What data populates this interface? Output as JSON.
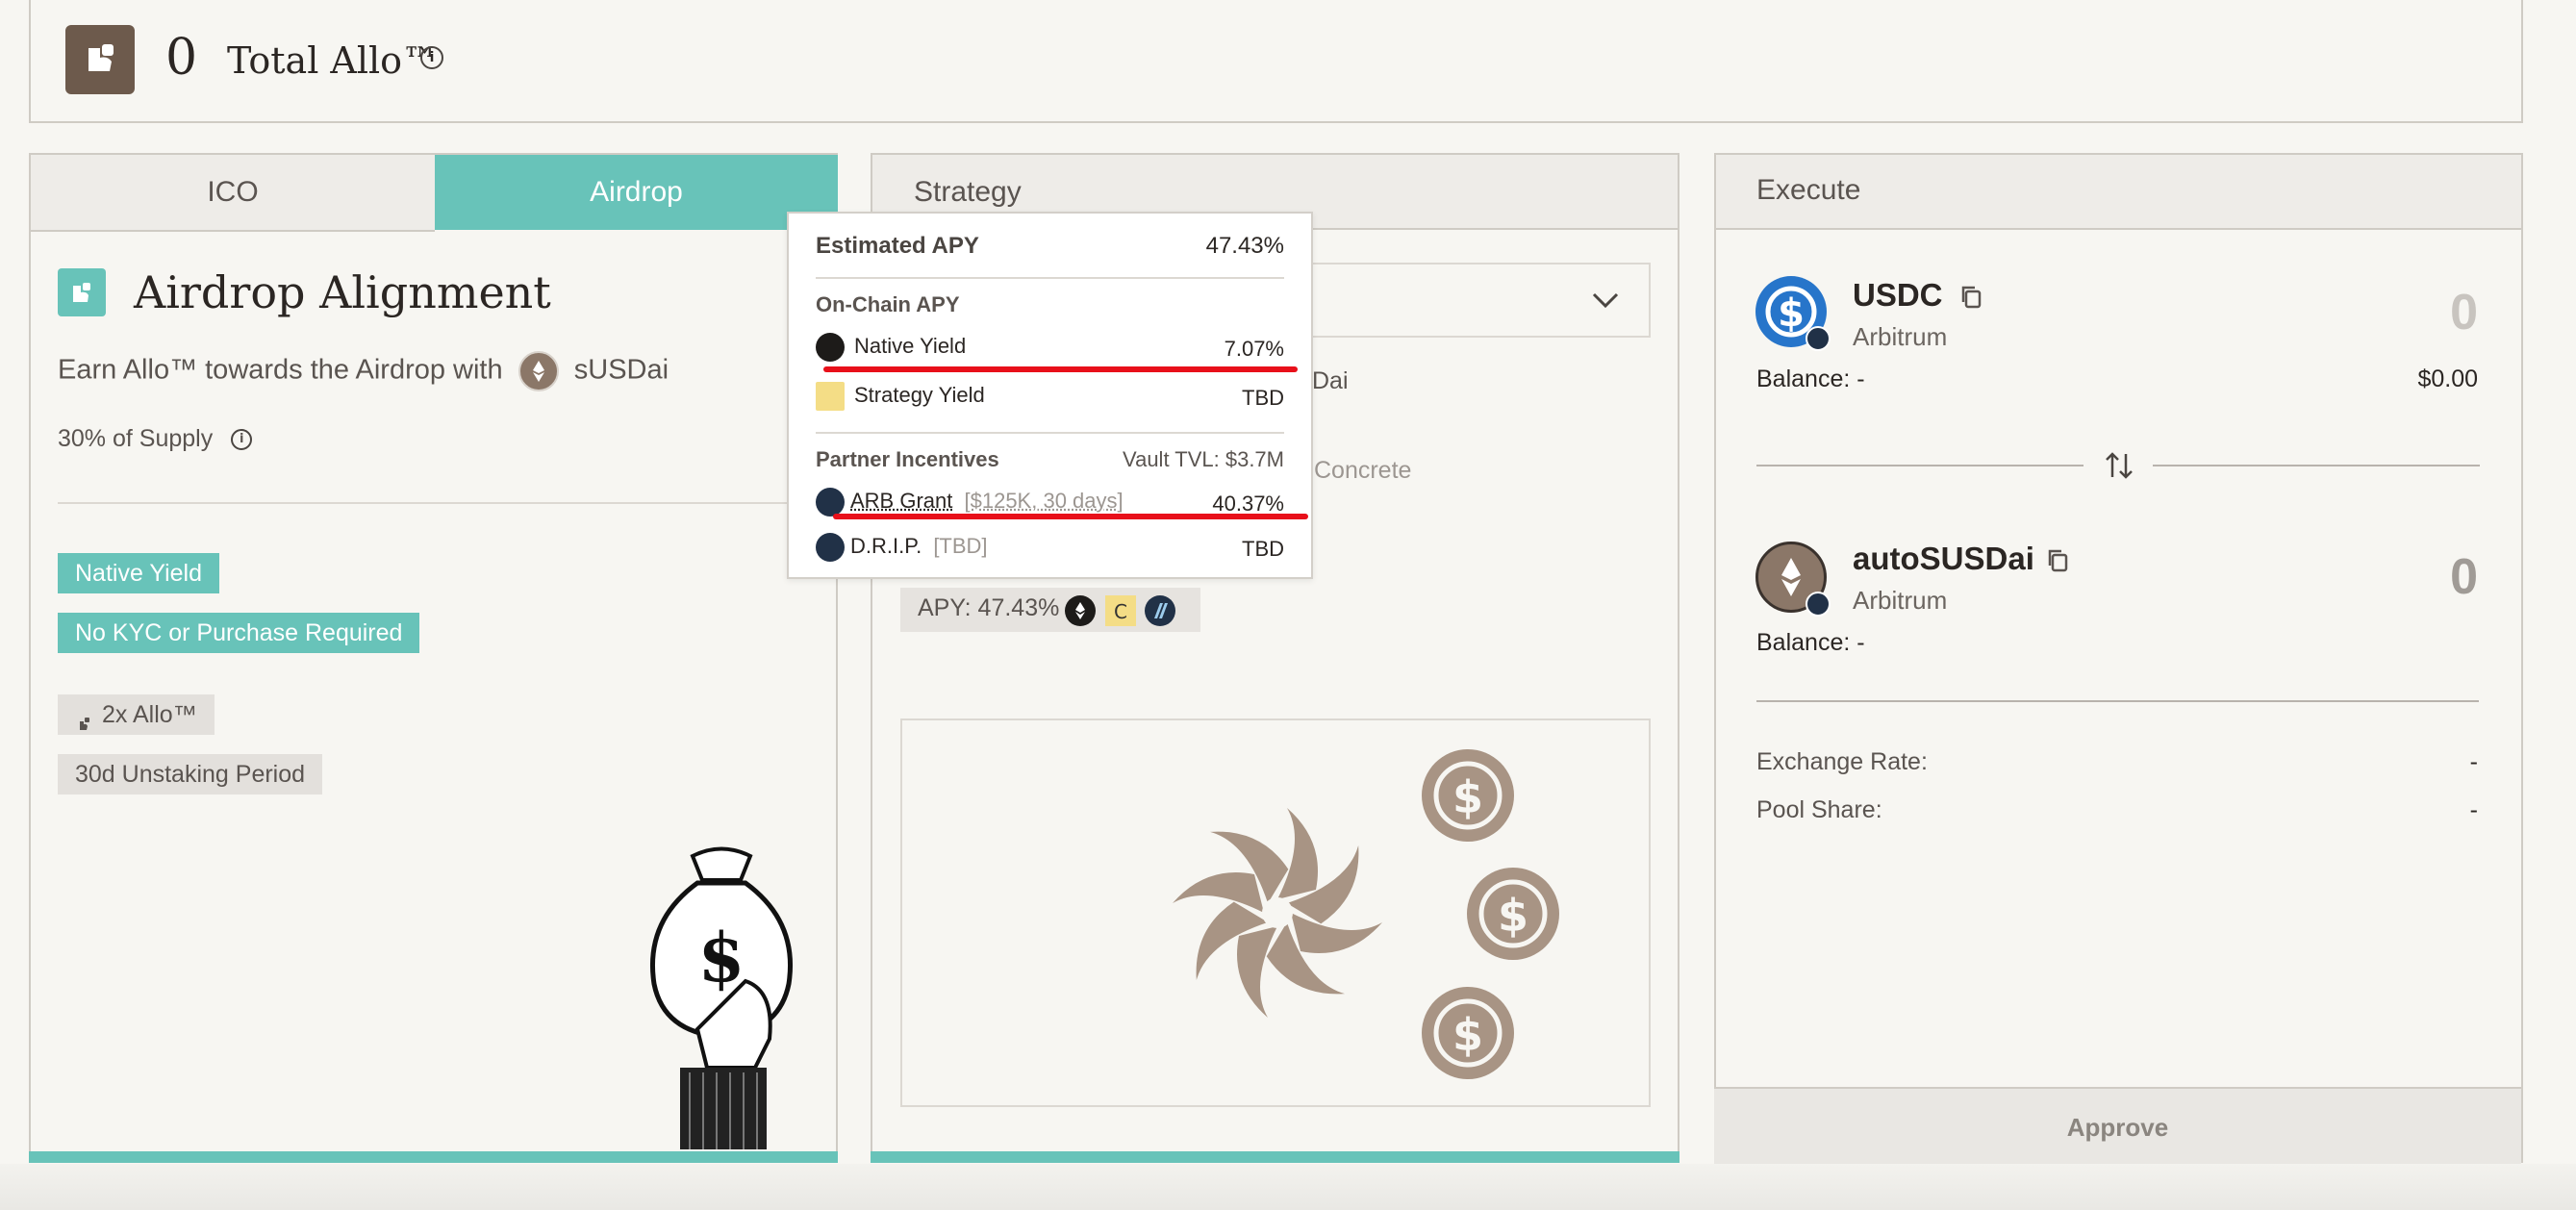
{
  "header": {
    "total_value": "0",
    "total_label": "Total Allo™"
  },
  "tabs": [
    {
      "label": "ICO",
      "active": false
    },
    {
      "label": "Airdrop",
      "active": true
    }
  ],
  "airdrop": {
    "title": "Airdrop Alignment",
    "subtitle_prefix": "Earn Allo™ towards the Airdrop with",
    "token": "sUSDai",
    "supply": "30% of Supply",
    "tags_teal": [
      "Native Yield",
      "No KYC or Purchase Required"
    ],
    "tags_grey": [
      "2x Allo™",
      "30d Unstaking Period"
    ]
  },
  "strategy": {
    "title": "Strategy",
    "partial_text_1": "Dai",
    "partial_text_2": "Concrete",
    "apy_badge": "APY: 47.43%"
  },
  "popup": {
    "estimated_label": "Estimated APY",
    "estimated_value": "47.43%",
    "onchain_label": "On-Chain APY",
    "native_label": "Native Yield",
    "native_value": "7.07%",
    "strategy_label": "Strategy Yield",
    "strategy_value": "TBD",
    "partner_label": "Partner Incentives",
    "vault_tvl": "Vault TVL: $3.7M",
    "arb_label": "ARB Grant",
    "arb_note": "[$125K, 30 days]",
    "arb_value": "40.37%",
    "drip_label": "D.R.I.P.",
    "drip_note": "[TBD]",
    "drip_value": "TBD"
  },
  "execute": {
    "title": "Execute",
    "from": {
      "token": "USDC",
      "network": "Arbitrum",
      "amount": "0",
      "balance_label": "Balance: -",
      "balance_usd": "$0.00"
    },
    "to": {
      "token": "autoSUSDai",
      "network": "Arbitrum",
      "amount": "0",
      "balance_label": "Balance: -"
    },
    "exchange_rate_label": "Exchange Rate:",
    "exchange_rate_value": "-",
    "pool_share_label": "Pool Share:",
    "pool_share_value": "-",
    "approve_label": "Approve"
  },
  "colors": {
    "teal": "#68c3b9",
    "brown": "#6d5a4c",
    "usdc_blue": "#2775ca",
    "red": "#e8101a",
    "taupe": "#a89484"
  }
}
